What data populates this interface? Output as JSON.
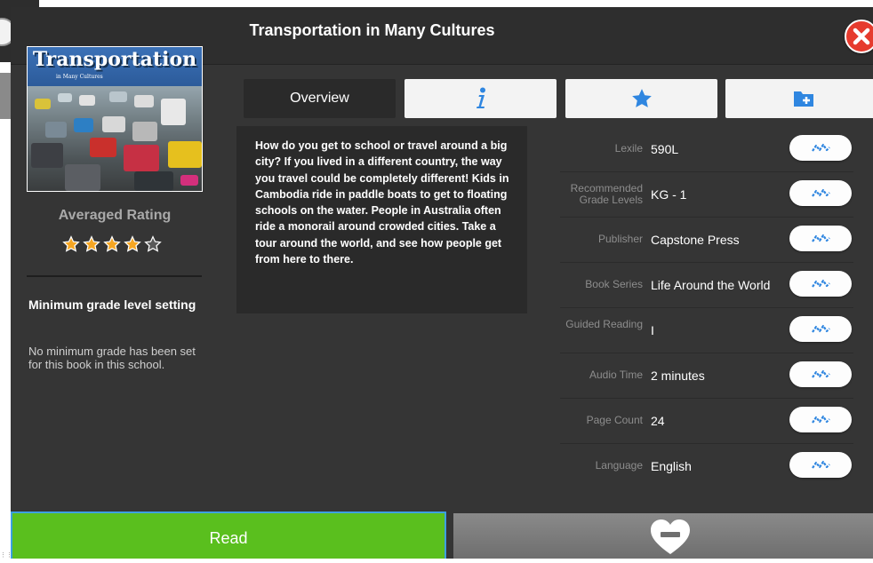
{
  "modal": {
    "title": "Transportation in Many Cultures"
  },
  "cover": {
    "title_text": "Transportation",
    "subtitle_text": "in Many Cultures"
  },
  "rating": {
    "label": "Averaged Rating",
    "value": 4,
    "max": 5
  },
  "min_grade": {
    "title": "Minimum grade level setting",
    "text": "No minimum grade has been set for this book in this school."
  },
  "tabs": [
    {
      "label": "Overview",
      "icon": null
    },
    {
      "label": "",
      "icon": "info-icon"
    },
    {
      "label": "",
      "icon": "star-icon"
    },
    {
      "label": "",
      "icon": "folder-add-icon"
    }
  ],
  "description": "How do you get to school or travel around a big city? If you lived in a different country, the way you travel could be completely different! Kids in Cambodia ride in paddle boats to get to floating schools on the water. People in Australia often ride a monorail around crowded cities. Take a tour around the world, and see how people get from here to there.",
  "details": [
    {
      "label": "Lexile",
      "value": "590L"
    },
    {
      "label": "Recommended Grade Levels",
      "value": "KG - 1"
    },
    {
      "label": "Publisher",
      "value": "Capstone Press"
    },
    {
      "label": "Book Series",
      "value": "Life Around the World"
    },
    {
      "label": "Guided Reading",
      "value": "I"
    },
    {
      "label": "Audio Time",
      "value": "2 minutes"
    },
    {
      "label": "Page Count",
      "value": "24"
    },
    {
      "label": "Language",
      "value": "English"
    }
  ],
  "buttons": {
    "read": "Read"
  },
  "colors": {
    "accent_blue": "#2f86e0",
    "read_green": "#5abf1e",
    "star_orange": "#f5a623",
    "close_red": "#e63b2e"
  }
}
